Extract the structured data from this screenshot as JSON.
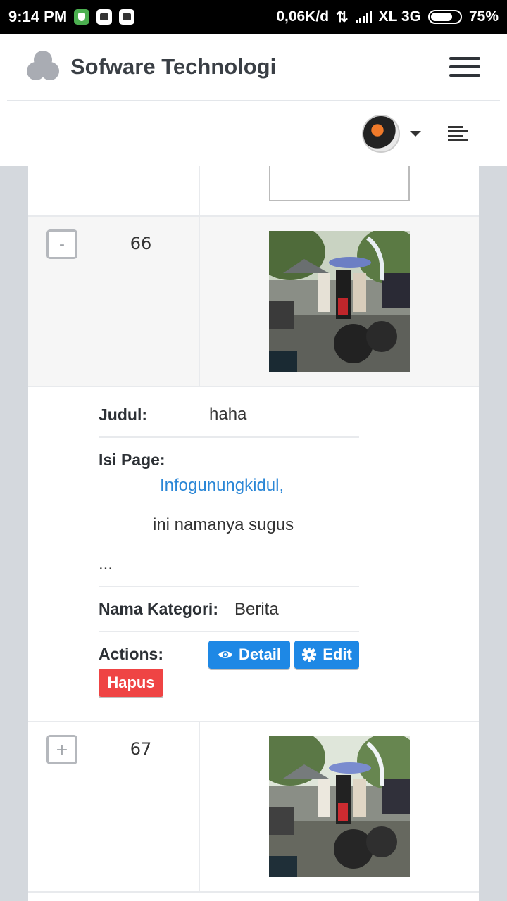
{
  "statusbar": {
    "time": "9:14 PM",
    "network_speed": "0,06K/d",
    "carrier": "XL 3G",
    "battery": "75%",
    "icons": [
      "shield-app-icon",
      "bbm-icon",
      "bbm-icon"
    ]
  },
  "header": {
    "brand": "Sofware Technologi",
    "logo_icon": "three-circles-logo",
    "menu_icon": "hamburger-icon",
    "align_icon": "text-align-icon"
  },
  "table": {
    "rows": [
      {
        "id": "66",
        "toggle": "-"
      },
      {
        "id": "67",
        "toggle": "+"
      }
    ],
    "detail": {
      "judul_label": "Judul:",
      "judul_value": "haha",
      "isi_label": "Isi Page:",
      "isi_link": "Infogunungkidul,",
      "isi_text": "ini namanya sugus",
      "isi_more": "...",
      "kategori_label": "Nama Kategori:",
      "kategori_value": "Berita",
      "actions_label": "Actions:",
      "btn_detail": "Detail",
      "btn_edit": "Edit",
      "btn_hapus": "Hapus"
    }
  },
  "colors": {
    "primary": "#1e88e5",
    "danger": "#ef4444",
    "link": "#2a86d6"
  }
}
